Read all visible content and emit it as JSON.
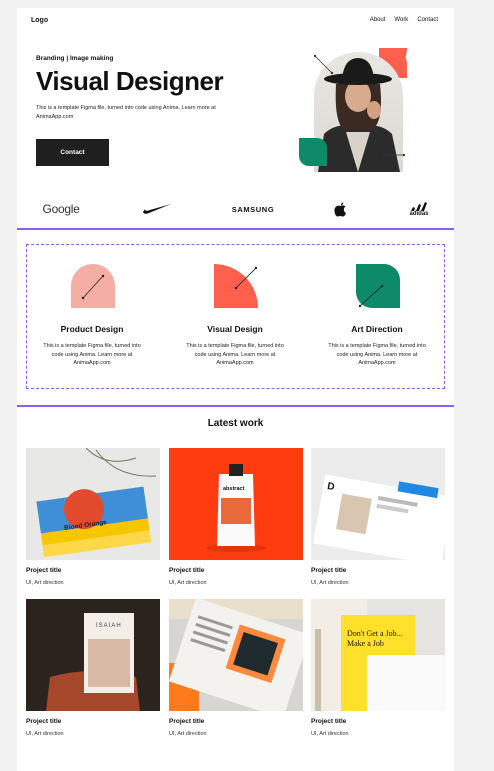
{
  "nav": {
    "logo": "Logo",
    "links": [
      "About",
      "Work",
      "Contact"
    ]
  },
  "hero": {
    "eyebrow": "Branding | Image making",
    "title": "Visual Designer",
    "description": "This is a template Figma file, turned into code using Anima. Learn more at AnimaApp.com",
    "cta": "Contact"
  },
  "brands": [
    "Google",
    "Nike",
    "SAMSUNG",
    "Apple",
    "adidas"
  ],
  "services": [
    {
      "title": "Product Design",
      "text": "This is a template Figma file, turned into code using Anima. Learn more at AnimaApp.com",
      "color": "#f4aea4"
    },
    {
      "title": "Visual Design",
      "text": "This is a template Figma file, turned into code using Anima. Learn more at AnimaApp.com",
      "color": "#ff5f4d"
    },
    {
      "title": "Art Direction",
      "text": "This is a template Figma file, turned into code using Anima. Learn more at AnimaApp.com",
      "color": "#0e8a68"
    }
  ],
  "latest_work": {
    "title": "Latest work",
    "projects": [
      {
        "title": "Project title",
        "subtitle": "UI, Art direction",
        "book_text": "Blood Orange"
      },
      {
        "title": "Project title",
        "subtitle": "UI, Art direction",
        "label_text": "abstract"
      },
      {
        "title": "Project title",
        "subtitle": "UI, Art direction"
      },
      {
        "title": "Project title",
        "subtitle": "UI, Art direction",
        "book_text": "ISAIAH"
      },
      {
        "title": "Project title",
        "subtitle": "UI, Art direction"
      },
      {
        "title": "Project title",
        "subtitle": "UI, Art direction",
        "book_text": "Don't Get a Job... Make a Job"
      }
    ]
  },
  "colors": {
    "accent_coral": "#ff5f4d",
    "accent_green": "#0e8a68",
    "accent_pink": "#f4aea4",
    "selection": "#8b5cf6",
    "button_bg": "#1f1f1f"
  }
}
